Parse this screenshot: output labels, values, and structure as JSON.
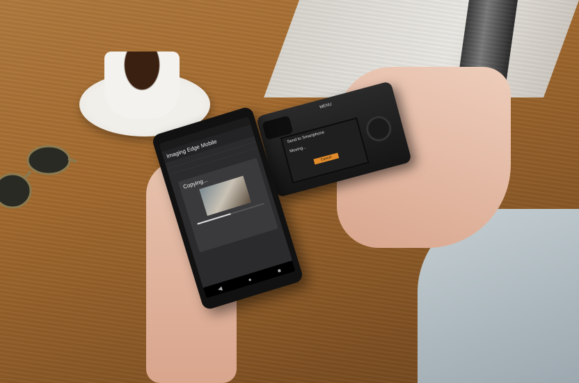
{
  "phone": {
    "app_title": "Imaging Edge Mobile",
    "dialog_title": "Copying...",
    "progress": 0.5
  },
  "camera": {
    "screen_title": "Send to Smartphone",
    "status": "Moving...",
    "cancel_label": "Cancel",
    "menu_button": "MENU"
  },
  "colors": {
    "camera_cancel_accent": "#e08a2a",
    "table_wood": "#a36a2f"
  }
}
